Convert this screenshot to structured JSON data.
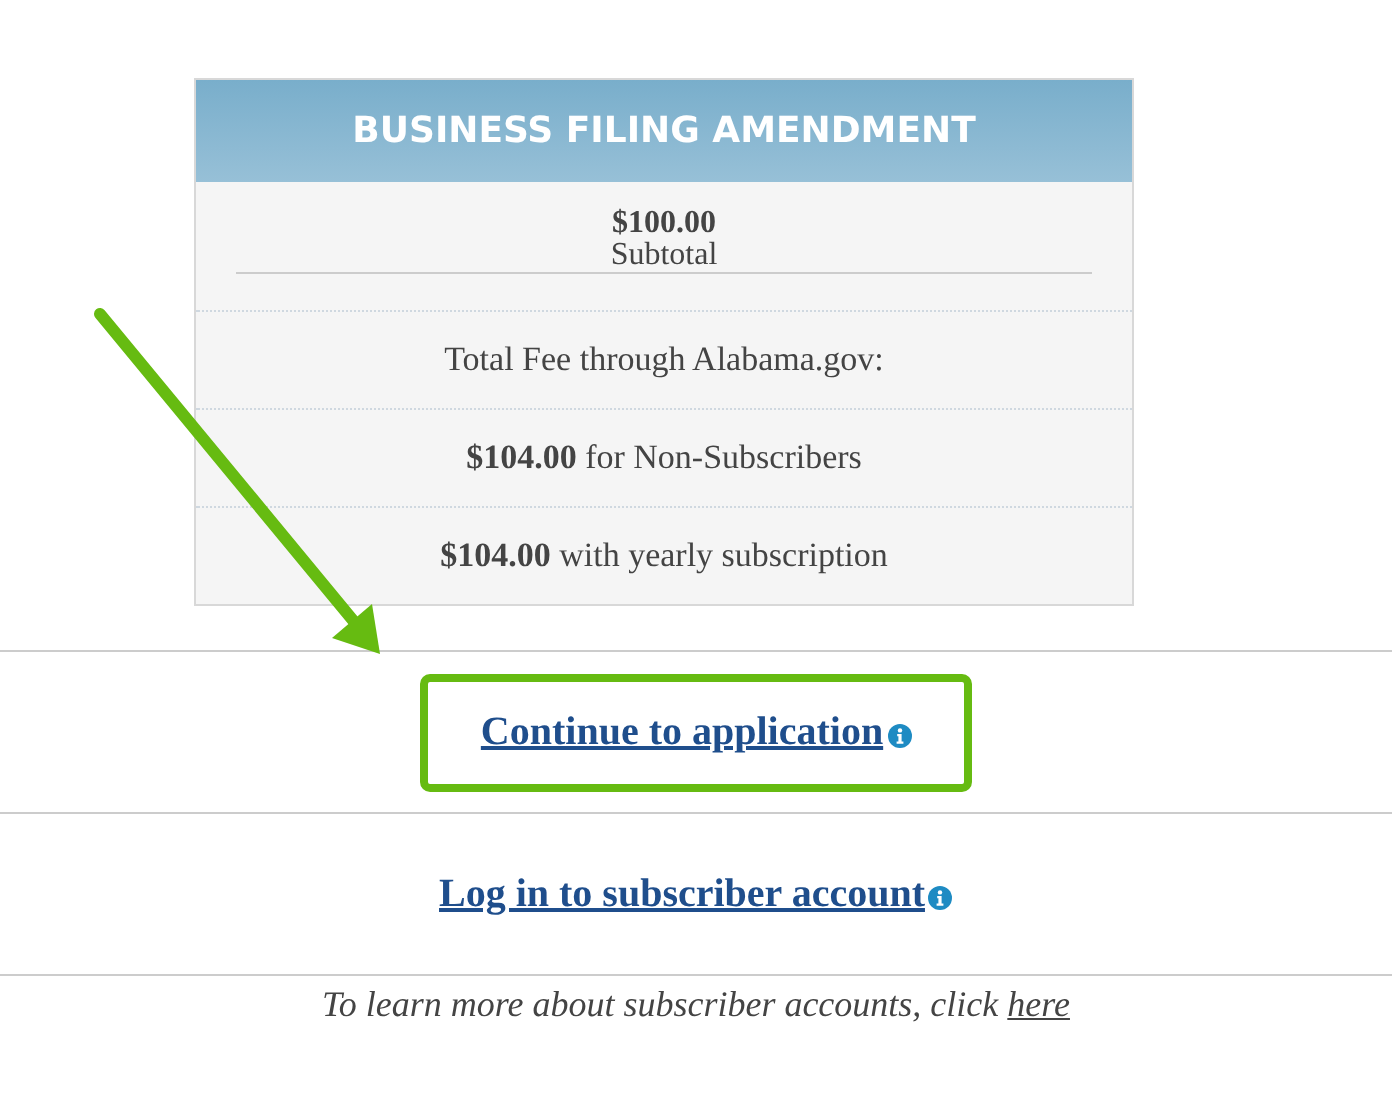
{
  "fee_card": {
    "title": "BUSINESS FILING AMENDMENT",
    "subtotal": {
      "amount": "$100.00",
      "label": "Subtotal"
    },
    "rows": [
      {
        "text": "Total Fee through Alabama.gov:"
      },
      {
        "text": "**$104.00** for Non-Subscribers"
      },
      {
        "text": "**$104.00** with yearly subscription"
      }
    ]
  },
  "actions": [
    {
      "label": "Continue to application",
      "highlighted": true
    },
    {
      "label": "Log in to subscriber account",
      "highlighted": false
    }
  ],
  "footer": {
    "text": "To learn more about subscriber accounts, click",
    "link": "here"
  },
  "annotation": {
    "kind": "arrow"
  }
}
